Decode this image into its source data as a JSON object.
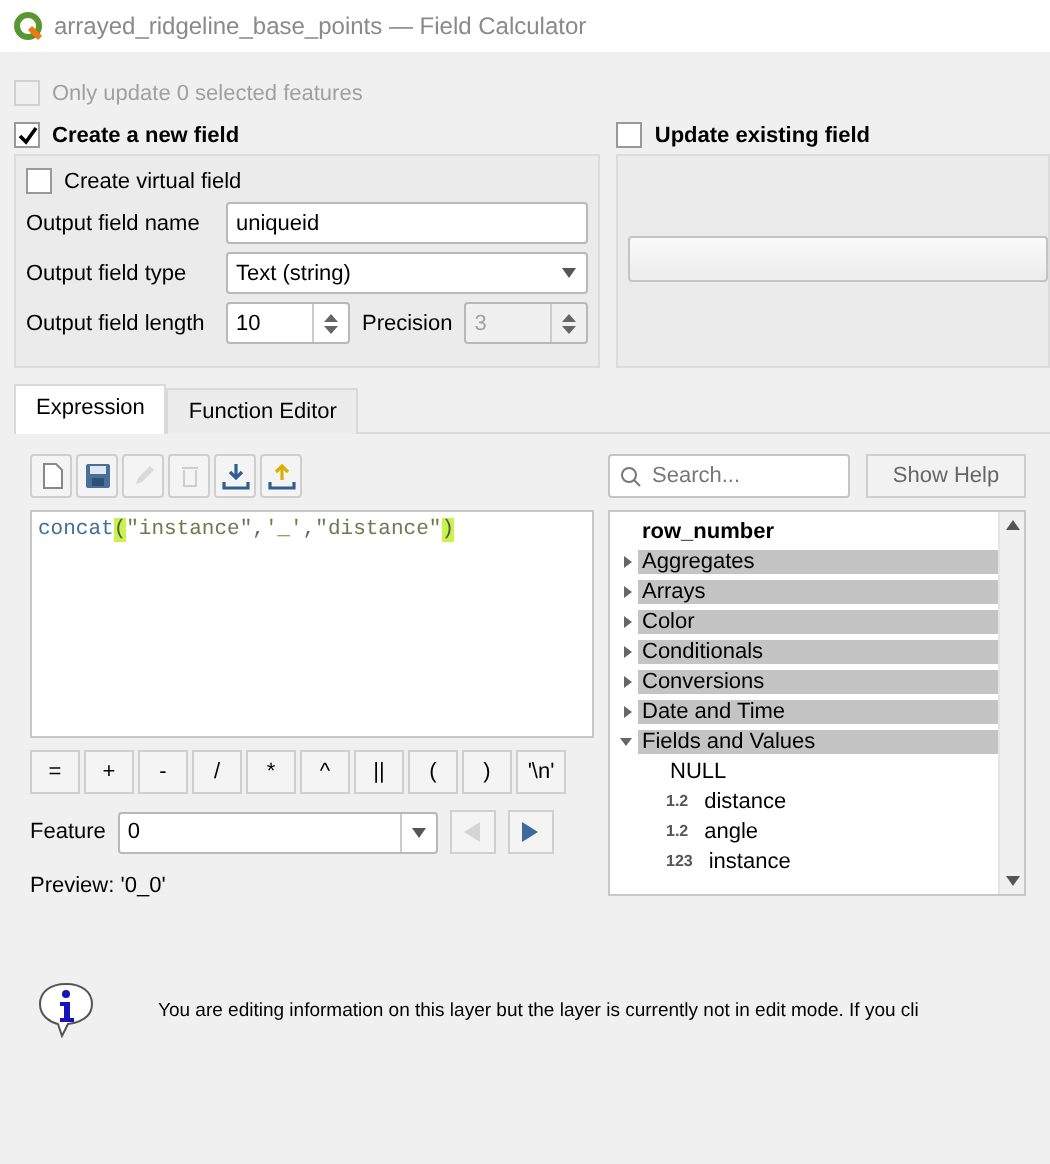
{
  "window": {
    "title": "arrayed_ridgeline_base_points — Field Calculator"
  },
  "only_selected": {
    "label": "Only update 0 selected features",
    "checked": false,
    "disabled": true
  },
  "new_field": {
    "label": "Create a new field",
    "checked": true,
    "virtual": {
      "label": "Create virtual field",
      "checked": false
    },
    "name": {
      "label": "Output field name",
      "value": "uniqueid"
    },
    "type": {
      "label": "Output field type",
      "value": "Text (string)"
    },
    "length": {
      "label": "Output field length",
      "value": "10"
    },
    "precision": {
      "label": "Precision",
      "value": "3",
      "disabled": true
    }
  },
  "update_field": {
    "label": "Update existing field",
    "checked": false
  },
  "tabs": [
    {
      "label": "Expression",
      "selected": true
    },
    {
      "label": "Function Editor",
      "selected": false
    }
  ],
  "toolbar": [
    {
      "kind": "new",
      "disabled": false
    },
    {
      "kind": "save",
      "disabled": false
    },
    {
      "kind": "edit",
      "disabled": true
    },
    {
      "kind": "delete",
      "disabled": true
    },
    {
      "kind": "import",
      "disabled": false
    },
    {
      "kind": "export",
      "disabled": false
    }
  ],
  "expression": [
    {
      "kind": "function",
      "text": "concat"
    },
    {
      "kind": "bracket",
      "text": "(",
      "matched": true
    },
    {
      "kind": "field",
      "text": "\"instance\""
    },
    {
      "kind": "operator",
      "text": ","
    },
    {
      "kind": "string",
      "text": "'_'"
    },
    {
      "kind": "operator",
      "text": ","
    },
    {
      "kind": "field",
      "text": "\"distance\""
    },
    {
      "kind": "bracket",
      "text": ")",
      "matched": true
    }
  ],
  "operators": [
    "=",
    "+",
    "-",
    "/",
    "*",
    "^",
    "||",
    "(",
    ")",
    "'\\n'"
  ],
  "feature": {
    "label": "Feature",
    "value": "0",
    "prev_disabled": true,
    "next_disabled": false
  },
  "preview": {
    "label": "Preview:",
    "value": "'0_0'"
  },
  "search": {
    "placeholder": "Search..."
  },
  "show_help": "Show Help",
  "tree": [
    {
      "kind": "function",
      "label": "row_number"
    },
    {
      "kind": "group",
      "label": "Aggregates",
      "expanded": false
    },
    {
      "kind": "group",
      "label": "Arrays",
      "expanded": false
    },
    {
      "kind": "group",
      "label": "Color",
      "expanded": false
    },
    {
      "kind": "group",
      "label": "Conditionals",
      "expanded": false
    },
    {
      "kind": "group",
      "label": "Conversions",
      "expanded": false
    },
    {
      "kind": "group",
      "label": "Date and Time",
      "expanded": false
    },
    {
      "kind": "group",
      "label": "Fields and Values",
      "expanded": true,
      "children": [
        {
          "kind": "value",
          "label": "NULL"
        },
        {
          "kind": "field",
          "type": "1.2",
          "label": "distance"
        },
        {
          "kind": "field",
          "type": "1.2",
          "label": "angle"
        },
        {
          "kind": "field",
          "type": "123",
          "label": "instance"
        }
      ]
    }
  ],
  "message": "You are editing information on this layer but the layer is currently not in edit mode. If you cli"
}
